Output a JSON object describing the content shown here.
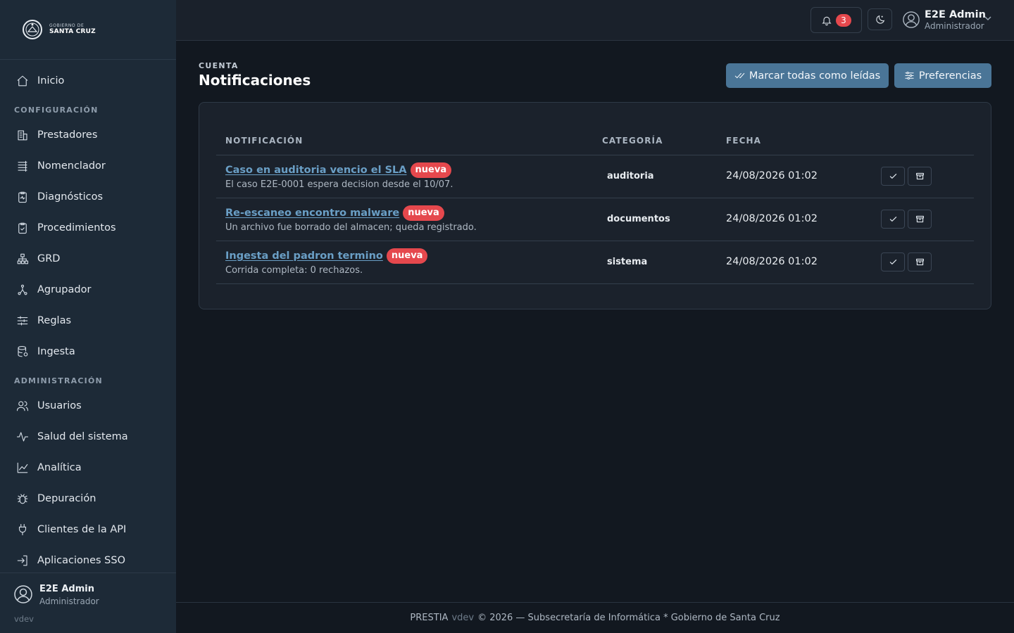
{
  "brand": {
    "line1": "GOBIERNO DE",
    "line2": "SANTA CRUZ"
  },
  "sidebar": {
    "home": "Inicio",
    "section_config": "CONFIGURACIÓN",
    "config_items": [
      "Prestadores",
      "Nomenclador",
      "Diagnósticos",
      "Procedimientos",
      "GRD",
      "Agrupador",
      "Reglas",
      "Ingesta"
    ],
    "section_admin": "ADMINISTRACIÓN",
    "admin_items": [
      "Usuarios",
      "Salud del sistema",
      "Analítica",
      "Depuración",
      "Clientes de la API",
      "Aplicaciones SSO"
    ],
    "user": {
      "name": "E2E Admin",
      "role": "Administrador"
    },
    "version": "vdev"
  },
  "topbar": {
    "notif_count": "3",
    "user": {
      "name": "E2E Admin",
      "role": "Administrador"
    }
  },
  "page": {
    "eyebrow": "CUENTA",
    "title": "Notificaciones",
    "mark_all_label": "Marcar todas como leídas",
    "preferences_label": "Preferencias"
  },
  "table": {
    "headers": {
      "notification": "NOTIFICACIÓN",
      "category": "CATEGORÍA",
      "date": "FECHA"
    },
    "rows": [
      {
        "title": "Caso en auditoria vencio el SLA",
        "badge": "nueva",
        "desc": "El caso E2E-0001 espera decision desde el 10/07.",
        "category": "auditoria",
        "date": "24/08/2026 01:02"
      },
      {
        "title": "Re-escaneo encontro malware",
        "badge": "nueva",
        "desc": "Un archivo fue borrado del almacen; queda registrado.",
        "category": "documentos",
        "date": "24/08/2026 01:02"
      },
      {
        "title": "Ingesta del padron termino",
        "badge": "nueva",
        "desc": "Corrida completa: 0 rechazos.",
        "category": "sistema",
        "date": "24/08/2026 01:02"
      }
    ]
  },
  "footer": {
    "app": "PRESTIA",
    "version": "vdev",
    "text": "© 2026 — Subsecretaría de Informática * Gobierno de Santa Cruz"
  }
}
